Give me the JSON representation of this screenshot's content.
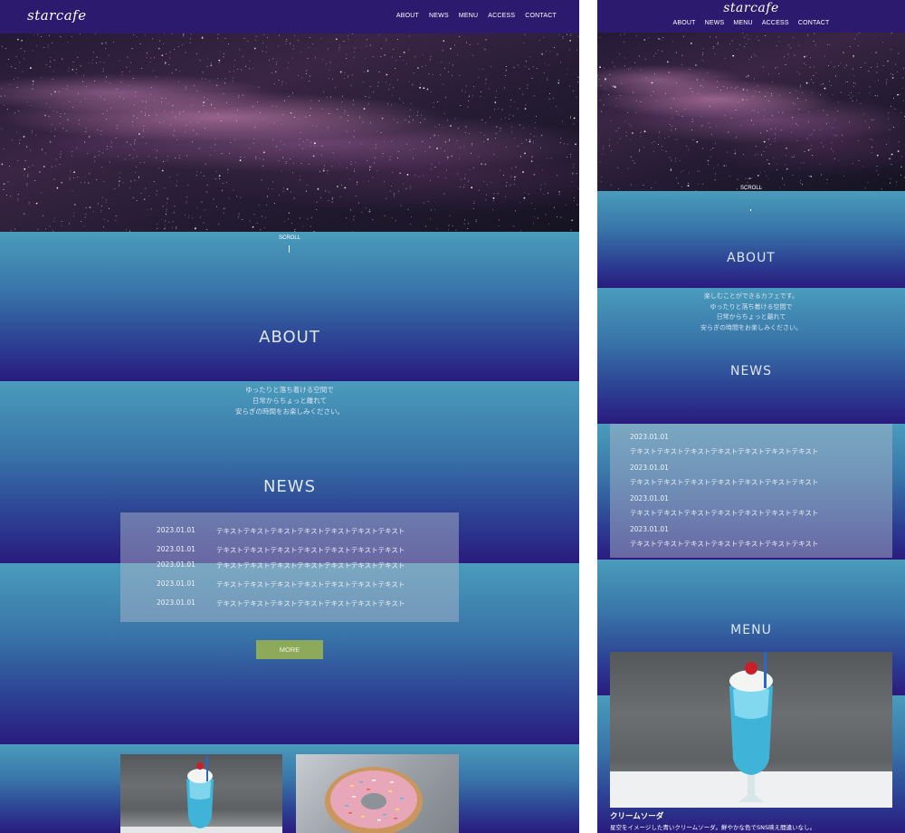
{
  "site": {
    "logo": "starcafe",
    "nav": [
      "ABOUT",
      "NEWS",
      "MENU",
      "ACCESS",
      "CONTACT"
    ]
  },
  "hero": {
    "scroll_label": "SCROLL"
  },
  "about": {
    "title": "ABOUT",
    "desktop_lines": [
      "ゆったりと落ち着ける空間で",
      "日常からちょっと離れて",
      "安らぎの時間をお楽しみください。"
    ],
    "mobile_lines": [
      "楽しむことができるカフェです。",
      "ゆったりと落ち着ける空間で",
      "日常からちょっと離れて",
      "安らぎの時間をお楽しみください。"
    ]
  },
  "news": {
    "title": "NEWS",
    "items": [
      {
        "date": "2023.01.01",
        "text": "テキストテキストテキストテキストテキストテキストテキスト"
      },
      {
        "date": "2023.01.01",
        "text": "テキストテキストテキストテキストテキストテキストテキスト"
      },
      {
        "date": "2023.01.01",
        "text": "テキストテキストテキストテキストテキストテキストテキスト"
      },
      {
        "date": "2023.01.01",
        "text": "テキストテキストテキストテキストテキストテキストテキスト"
      },
      {
        "date": "2023.01.01",
        "text": "テキストテキストテキストテキストテキストテキストテキスト"
      }
    ],
    "more_label": "MORE"
  },
  "menu": {
    "title": "MENU",
    "items": [
      {
        "name": "クリームソーダ",
        "desc": "星空をイメージした青いクリームソーダ。鮮やかな色でSNS映え間違いなし。"
      }
    ]
  },
  "colors": {
    "header": "#2b1a6e",
    "band_top": "#4a9cbc",
    "band_bottom": "#2a1b7e",
    "more_button": "#8caa5a"
  }
}
